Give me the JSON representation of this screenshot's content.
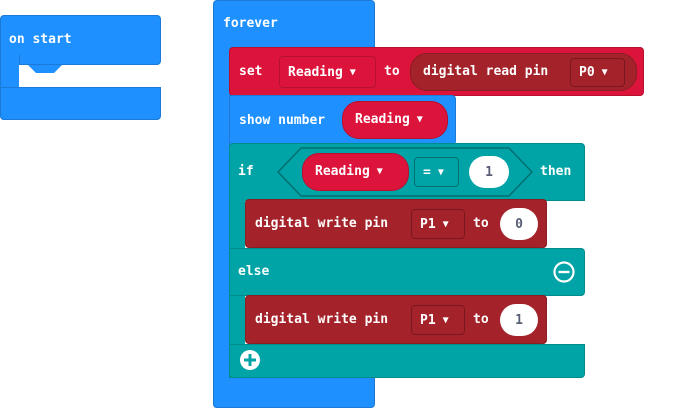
{
  "on_start": {
    "label": "on start"
  },
  "forever": {
    "label": "forever"
  },
  "set_block": {
    "set_label": "set",
    "variable": "Reading",
    "to_label": "to",
    "reporter_label": "digital read pin",
    "pin": "P0"
  },
  "show_number": {
    "label": "show number",
    "variable": "Reading"
  },
  "if_block": {
    "if_label": "if",
    "variable": "Reading",
    "operator": "=",
    "value": "1",
    "then_label": "then",
    "else_label": "else"
  },
  "write_then": {
    "label": "digital write pin",
    "pin": "P1",
    "to_label": "to",
    "value": "0"
  },
  "write_else": {
    "label": "digital write pin",
    "pin": "P1",
    "to_label": "to",
    "value": "1"
  },
  "colors": {
    "events_blue": "#1e90ff",
    "variables_red": "#dc143c",
    "pins_dark_red": "#a4232b",
    "logic_teal": "#00a4a6"
  },
  "icons": {
    "remove_else": "minus-circle-icon",
    "add_else_if": "plus-circle-icon"
  }
}
